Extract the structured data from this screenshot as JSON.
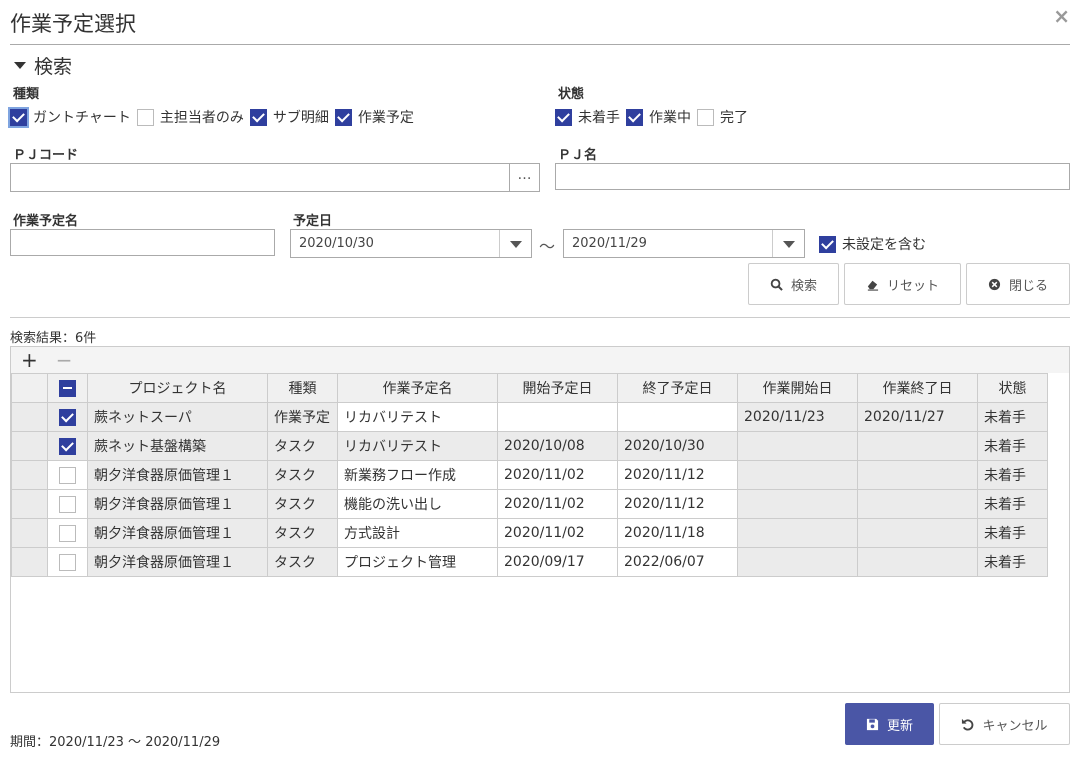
{
  "dialog": {
    "title": "作業予定選択",
    "close_label": "×"
  },
  "search": {
    "section_label": "検索",
    "kind": {
      "label": "種類",
      "options": [
        {
          "label": "ガントチャート",
          "checked": true
        },
        {
          "label": "主担当者のみ",
          "checked": false
        },
        {
          "label": "サブ明細",
          "checked": true
        },
        {
          "label": "作業予定",
          "checked": true
        }
      ]
    },
    "status": {
      "label": "状態",
      "options": [
        {
          "label": "未着手",
          "checked": true
        },
        {
          "label": "作業中",
          "checked": true
        },
        {
          "label": "完了",
          "checked": false
        }
      ]
    },
    "pj_code": {
      "label": "ＰＪコード",
      "value": "",
      "button_label": "…"
    },
    "pj_name": {
      "label": "ＰＪ名",
      "value": ""
    },
    "task_name": {
      "label": "作業予定名",
      "value": ""
    },
    "scheduled_date": {
      "label": "予定日",
      "from": "2020/10/30",
      "separator": "～",
      "to": "2020/11/29"
    },
    "include_unset": {
      "label": "未設定を含む",
      "checked": true
    },
    "buttons": {
      "search": "検索",
      "reset": "リセット",
      "close": "閉じる"
    }
  },
  "results": {
    "count_text": "検索結果：6件",
    "toolbar": {
      "add": "+",
      "remove": "−"
    },
    "columns": [
      "プロジェクト名",
      "種類",
      "作業予定名",
      "開始予定日",
      "終了予定日",
      "作業開始日",
      "作業終了日",
      "状態"
    ],
    "rows": [
      {
        "checked": true,
        "project": "蕨ネットスーパ",
        "kind": "作業予定",
        "task": "リカバリテスト",
        "start_plan": "",
        "end_plan": "",
        "work_start": "2020/11/23",
        "work_end": "2020/11/27",
        "status": "未着手"
      },
      {
        "checked": true,
        "project": "蕨ネット基盤構築",
        "kind": "タスク",
        "task": "リカバリテスト",
        "start_plan": "2020/10/08",
        "end_plan": "2020/10/30",
        "work_start": "",
        "work_end": "",
        "status": "未着手"
      },
      {
        "checked": false,
        "project": "朝夕洋食器原価管理１",
        "kind": "タスク",
        "task": "新業務フロー作成",
        "start_plan": "2020/11/02",
        "end_plan": "2020/11/12",
        "work_start": "",
        "work_end": "",
        "status": "未着手"
      },
      {
        "checked": false,
        "project": "朝夕洋食器原価管理１",
        "kind": "タスク",
        "task": "機能の洗い出し",
        "start_plan": "2020/11/02",
        "end_plan": "2020/11/12",
        "work_start": "",
        "work_end": "",
        "status": "未着手"
      },
      {
        "checked": false,
        "project": "朝夕洋食器原価管理１",
        "kind": "タスク",
        "task": "方式設計",
        "start_plan": "2020/11/02",
        "end_plan": "2020/11/18",
        "work_start": "",
        "work_end": "",
        "status": "未着手"
      },
      {
        "checked": false,
        "project": "朝夕洋食器原価管理１",
        "kind": "タスク",
        "task": "プロジェクト管理",
        "start_plan": "2020/09/17",
        "end_plan": "2022/06/07",
        "work_start": "",
        "work_end": "",
        "status": "未着手"
      }
    ]
  },
  "footer": {
    "period_text": "期間：2020/11/23 ～ 2020/11/29",
    "update_label": "更新",
    "cancel_label": "キャンセル"
  },
  "colors": {
    "accent": "#2f3f9e",
    "primary_button": "#4a56a6"
  }
}
